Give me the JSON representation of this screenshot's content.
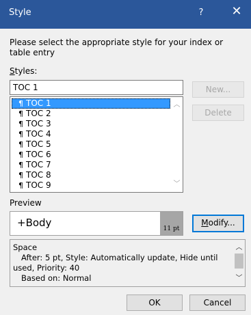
{
  "dialog": {
    "title": "Style",
    "help": "?",
    "close": "✕"
  },
  "instruction": "Please select the appropriate style for your index or table entry",
  "styles_label": "Styles:",
  "style_input_value": "TOC 1",
  "style_list": {
    "items": [
      "TOC 1",
      "TOC 2",
      "TOC 3",
      "TOC 4",
      "TOC 5",
      "TOC 6",
      "TOC 7",
      "TOC 8",
      "TOC 9"
    ],
    "selected": "TOC 1",
    "item_icon": "¶"
  },
  "buttons": {
    "new": "New...",
    "delete": "Delete",
    "modify": "Modify...",
    "ok": "OK",
    "cancel": "Cancel"
  },
  "preview": {
    "label": "Preview",
    "font_name": "+Body",
    "size": "11 pt"
  },
  "description": {
    "line1": "Space",
    "line2": "After:  5 pt, Style: Automatically update, Hide until",
    "line3": "used, Priority: 40",
    "line4": "Based on: Normal"
  },
  "colors": {
    "titlebar": "#2b579a",
    "selection": "#3399ff",
    "focus_border": "#0078d7"
  }
}
